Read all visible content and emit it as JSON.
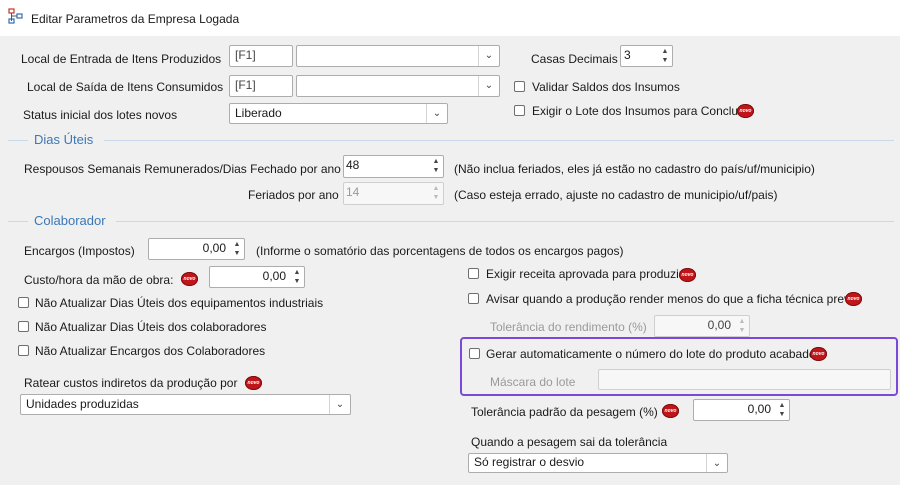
{
  "window": {
    "title": "Editar Parametros da Empresa Logada"
  },
  "badge_text": "novo",
  "top": {
    "local_entrada_label": "Local de Entrada de Itens Produzidos",
    "local_entrada_code": "[F1]",
    "local_entrada_value": "",
    "local_saida_label": "Local de Saída de Itens Consumidos",
    "local_saida_code": "[F1]",
    "local_saida_value": "",
    "status_label": "Status inicial dos lotes novos",
    "status_value": "Liberado",
    "casas_label": "Casas Decimais",
    "casas_value": "3",
    "validar_label": "Validar Saldos dos Insumos",
    "exigir_lote_label": "Exigir o Lote dos Insumos para Concluir"
  },
  "dias_uteis": {
    "heading": "Dias Úteis",
    "repousos_label": "Respousos Semanais Remunerados/Dias Fechado por ano",
    "repousos_value": "48",
    "repousos_hint": "(Não inclua feriados, eles já estão no cadastro do país/uf/municipio)",
    "feriados_label": "Feriados por ano",
    "feriados_value": "14",
    "feriados_hint": "(Caso esteja errado, ajuste no cadastro de municipio/uf/pais)"
  },
  "colaborador": {
    "heading": "Colaborador",
    "encargos_label": "Encargos (Impostos)",
    "encargos_value": "0,00",
    "encargos_hint": "(Informe o somatório das porcentagens de todos os encargos pagos)",
    "custo_label": "Custo/hora da mão de obra:",
    "custo_value": "0,00",
    "nao_atualizar_equip_label": "Não Atualizar Dias Úteis dos equipamentos industriais",
    "nao_atualizar_colab_label": "Não Atualizar Dias Úteis dos colaboradores",
    "nao_atualizar_encargos_label": "Não Atualizar Encargos dos Colaboradores",
    "ratear_label": "Ratear custos indiretos da produção por",
    "ratear_value": "Unidades produzidas"
  },
  "right": {
    "exigir_receita_label": "Exigir receita aprovada para produzir",
    "avisar_label": "Avisar quando a produção render menos do que a ficha técnica previa",
    "tolerancia_rend_label": "Tolerância do rendimento (%)",
    "tolerancia_rend_value": "0,00",
    "gerar_lote_label": "Gerar automaticamente o número do lote do produto acabado",
    "mascara_label": "Máscara do lote",
    "mascara_value": "",
    "tolerancia_pesagem_label": "Tolerância padrão da pesagem (%)",
    "tolerancia_pesagem_value": "0,00",
    "quando_label": "Quando a pesagem sai da tolerância",
    "quando_value": "Só registrar o desvio"
  }
}
